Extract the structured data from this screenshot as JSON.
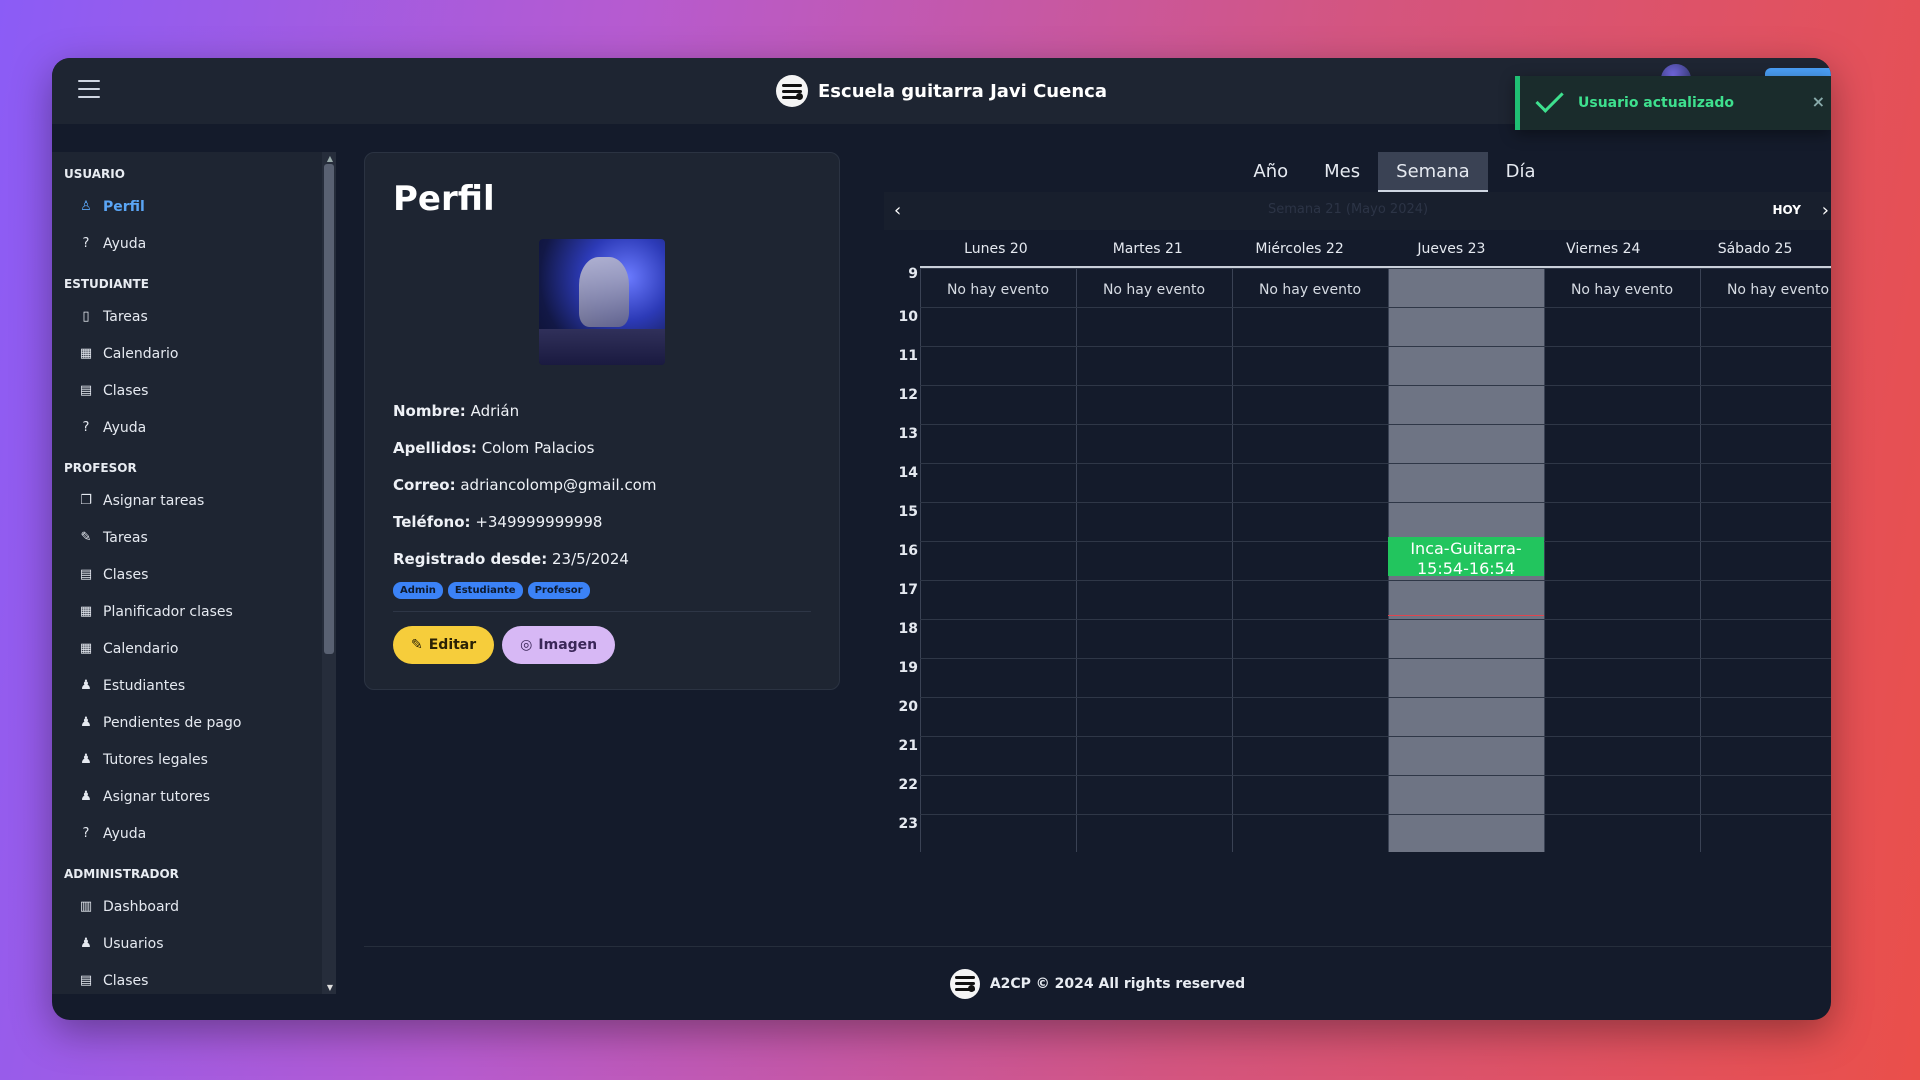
{
  "header": {
    "title": "Escuela guitarra Javi Cuenca"
  },
  "toast": {
    "message": "Usuario actualizado",
    "close_symbol": "×"
  },
  "sidebar": {
    "sections": [
      {
        "title": "USUARIO",
        "items": [
          {
            "label": "Perfil",
            "icon": "user-icon",
            "active": true
          },
          {
            "label": "Ayuda",
            "icon": "help-icon"
          }
        ]
      },
      {
        "title": "ESTUDIANTE",
        "items": [
          {
            "label": "Tareas",
            "icon": "file-icon"
          },
          {
            "label": "Calendario",
            "icon": "calendar-icon"
          },
          {
            "label": "Clases",
            "icon": "briefcase-icon"
          },
          {
            "label": "Ayuda",
            "icon": "help-icon"
          }
        ]
      },
      {
        "title": "PROFESOR",
        "items": [
          {
            "label": "Asignar tareas",
            "icon": "copy-icon"
          },
          {
            "label": "Tareas",
            "icon": "file-edit-icon"
          },
          {
            "label": "Clases",
            "icon": "briefcase-icon"
          },
          {
            "label": "Planificador clases",
            "icon": "calendar-icon"
          },
          {
            "label": "Calendario",
            "icon": "calendar-icon"
          },
          {
            "label": "Estudiantes",
            "icon": "users-icon"
          },
          {
            "label": "Pendientes de pago",
            "icon": "users-icon"
          },
          {
            "label": "Tutores legales",
            "icon": "users-icon"
          },
          {
            "label": "Asignar tutores",
            "icon": "users-icon"
          },
          {
            "label": "Ayuda",
            "icon": "help-icon"
          }
        ]
      },
      {
        "title": "ADMINISTRADOR",
        "items": [
          {
            "label": "Dashboard",
            "icon": "chart-icon"
          },
          {
            "label": "Usuarios",
            "icon": "users-icon"
          },
          {
            "label": "Clases",
            "icon": "briefcase-icon"
          }
        ]
      }
    ]
  },
  "profile": {
    "title": "Perfil",
    "fields": [
      {
        "label": "Nombre:",
        "value": "Adrián"
      },
      {
        "label": "Apellidos:",
        "value": "Colom Palacios"
      },
      {
        "label": "Correo:",
        "value": "adriancolomp@gmail.com"
      },
      {
        "label": "Teléfono:",
        "value": "+349999999998"
      },
      {
        "label": "Registrado desde:",
        "value": "23/5/2024"
      }
    ],
    "badges": [
      "Admin",
      "Estudiante",
      "Profesor"
    ],
    "edit_label": "Editar",
    "image_label": "Imagen"
  },
  "calendar": {
    "views": [
      {
        "label": "Año"
      },
      {
        "label": "Mes"
      },
      {
        "label": "Semana",
        "active": true
      },
      {
        "label": "Día"
      }
    ],
    "period_label": "Semana 21 (Mayo 2024)",
    "today_label": "HOY",
    "days": [
      {
        "label": "Lunes 20",
        "empty_label": "No hay evento"
      },
      {
        "label": "Martes 21",
        "empty_label": "No hay evento"
      },
      {
        "label": "Miércoles 22",
        "empty_label": "No hay evento"
      },
      {
        "label": "Jueves 23",
        "empty_label": "",
        "today": true
      },
      {
        "label": "Viernes 24",
        "empty_label": "No hay evento"
      },
      {
        "label": "Sábado 25",
        "empty_label": "No hay evento"
      }
    ],
    "hours": [
      "9",
      "10",
      "11",
      "12",
      "13",
      "14",
      "15",
      "16",
      "17",
      "18",
      "19",
      "20",
      "21",
      "22",
      "23"
    ],
    "events": [
      {
        "day_index": 3,
        "label": "Inca-Guitarra-15:54-16:54",
        "start": "15:54",
        "end": "16:54"
      }
    ],
    "now_time": "17:54",
    "event_color": "#22c55e"
  },
  "footer": {
    "text": "A2CP © 2024 All rights reserved"
  }
}
